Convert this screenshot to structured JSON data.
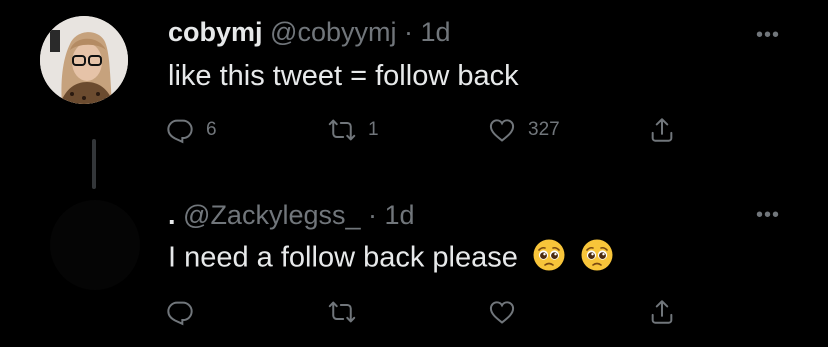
{
  "tweets": [
    {
      "name": "cobymj",
      "handle": "@cobyymj",
      "separator": "·",
      "time": "1d",
      "text": "like this tweet = follow back",
      "more_icon": "•••",
      "counts": {
        "replies": "6",
        "retweets": "1",
        "likes": "327"
      }
    },
    {
      "name": ".",
      "handle": "@Zackylegss_",
      "separator": "·",
      "time": "1d",
      "text": "I need a follow back please",
      "more_icon": "•••",
      "emojis": [
        "pleading-face",
        "pleading-face"
      ]
    }
  ],
  "icons": {
    "reply": "reply-icon",
    "retweet": "retweet-icon",
    "like": "heart-icon",
    "share": "share-icon"
  },
  "colors": {
    "background": "#000000",
    "text": "#e7e9ea",
    "secondary": "#71767b",
    "thread_line": "#333639"
  }
}
